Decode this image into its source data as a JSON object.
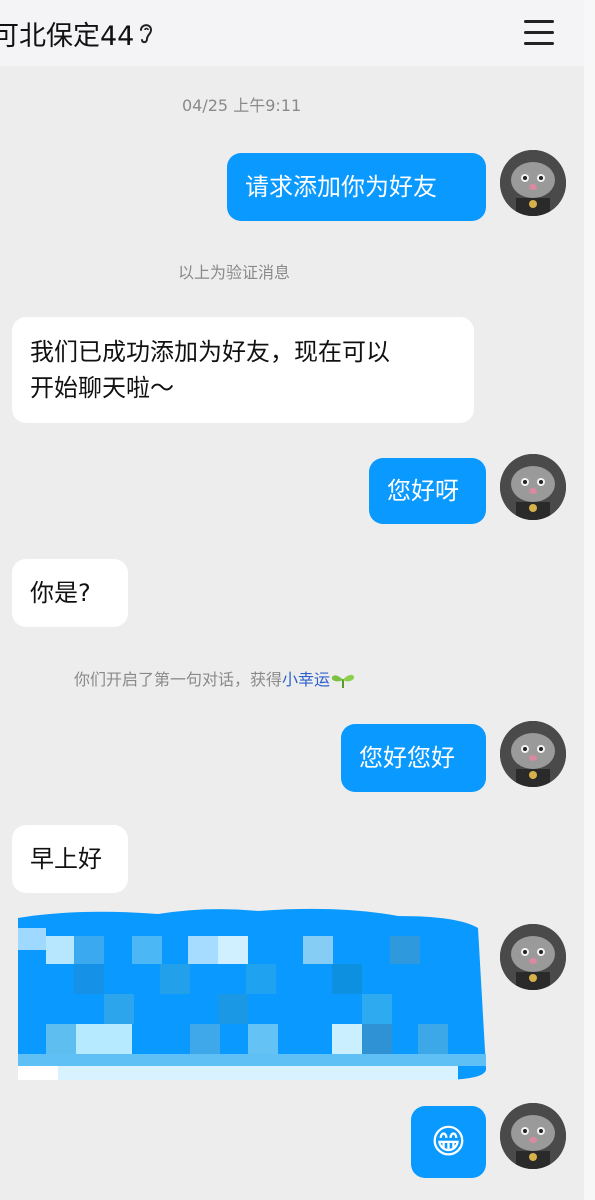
{
  "header": {
    "title": "可北保定44",
    "ear_icon": "ear-icon",
    "menu_icon": "hamburger-menu-icon"
  },
  "chat": {
    "timestamp": "04/25 上午9:11",
    "messages": [
      {
        "side": "out",
        "text": "请求添加你为好友"
      },
      {
        "side": "notice",
        "text": "以上为验证消息"
      },
      {
        "side": "in",
        "text_line1": "我们已成功添加为好友，现在可以",
        "text_line2": "开始聊天啦～"
      },
      {
        "side": "out",
        "text": "您好呀"
      },
      {
        "side": "in",
        "text": "你是?"
      },
      {
        "side": "notice",
        "text": "你们开启了第一句对话，获得",
        "link": "小幸运"
      },
      {
        "side": "out",
        "text": "您好您好"
      },
      {
        "side": "in",
        "text": "早上好"
      },
      {
        "side": "out",
        "type": "pixelated-blurred-message"
      },
      {
        "side": "out",
        "type": "emoji",
        "emoji": "😁"
      }
    ]
  },
  "colors": {
    "outgoing_bubble": "#0a99ff",
    "incoming_bubble": "#ffffff",
    "background": "#ededed",
    "link": "#2f62c9"
  }
}
